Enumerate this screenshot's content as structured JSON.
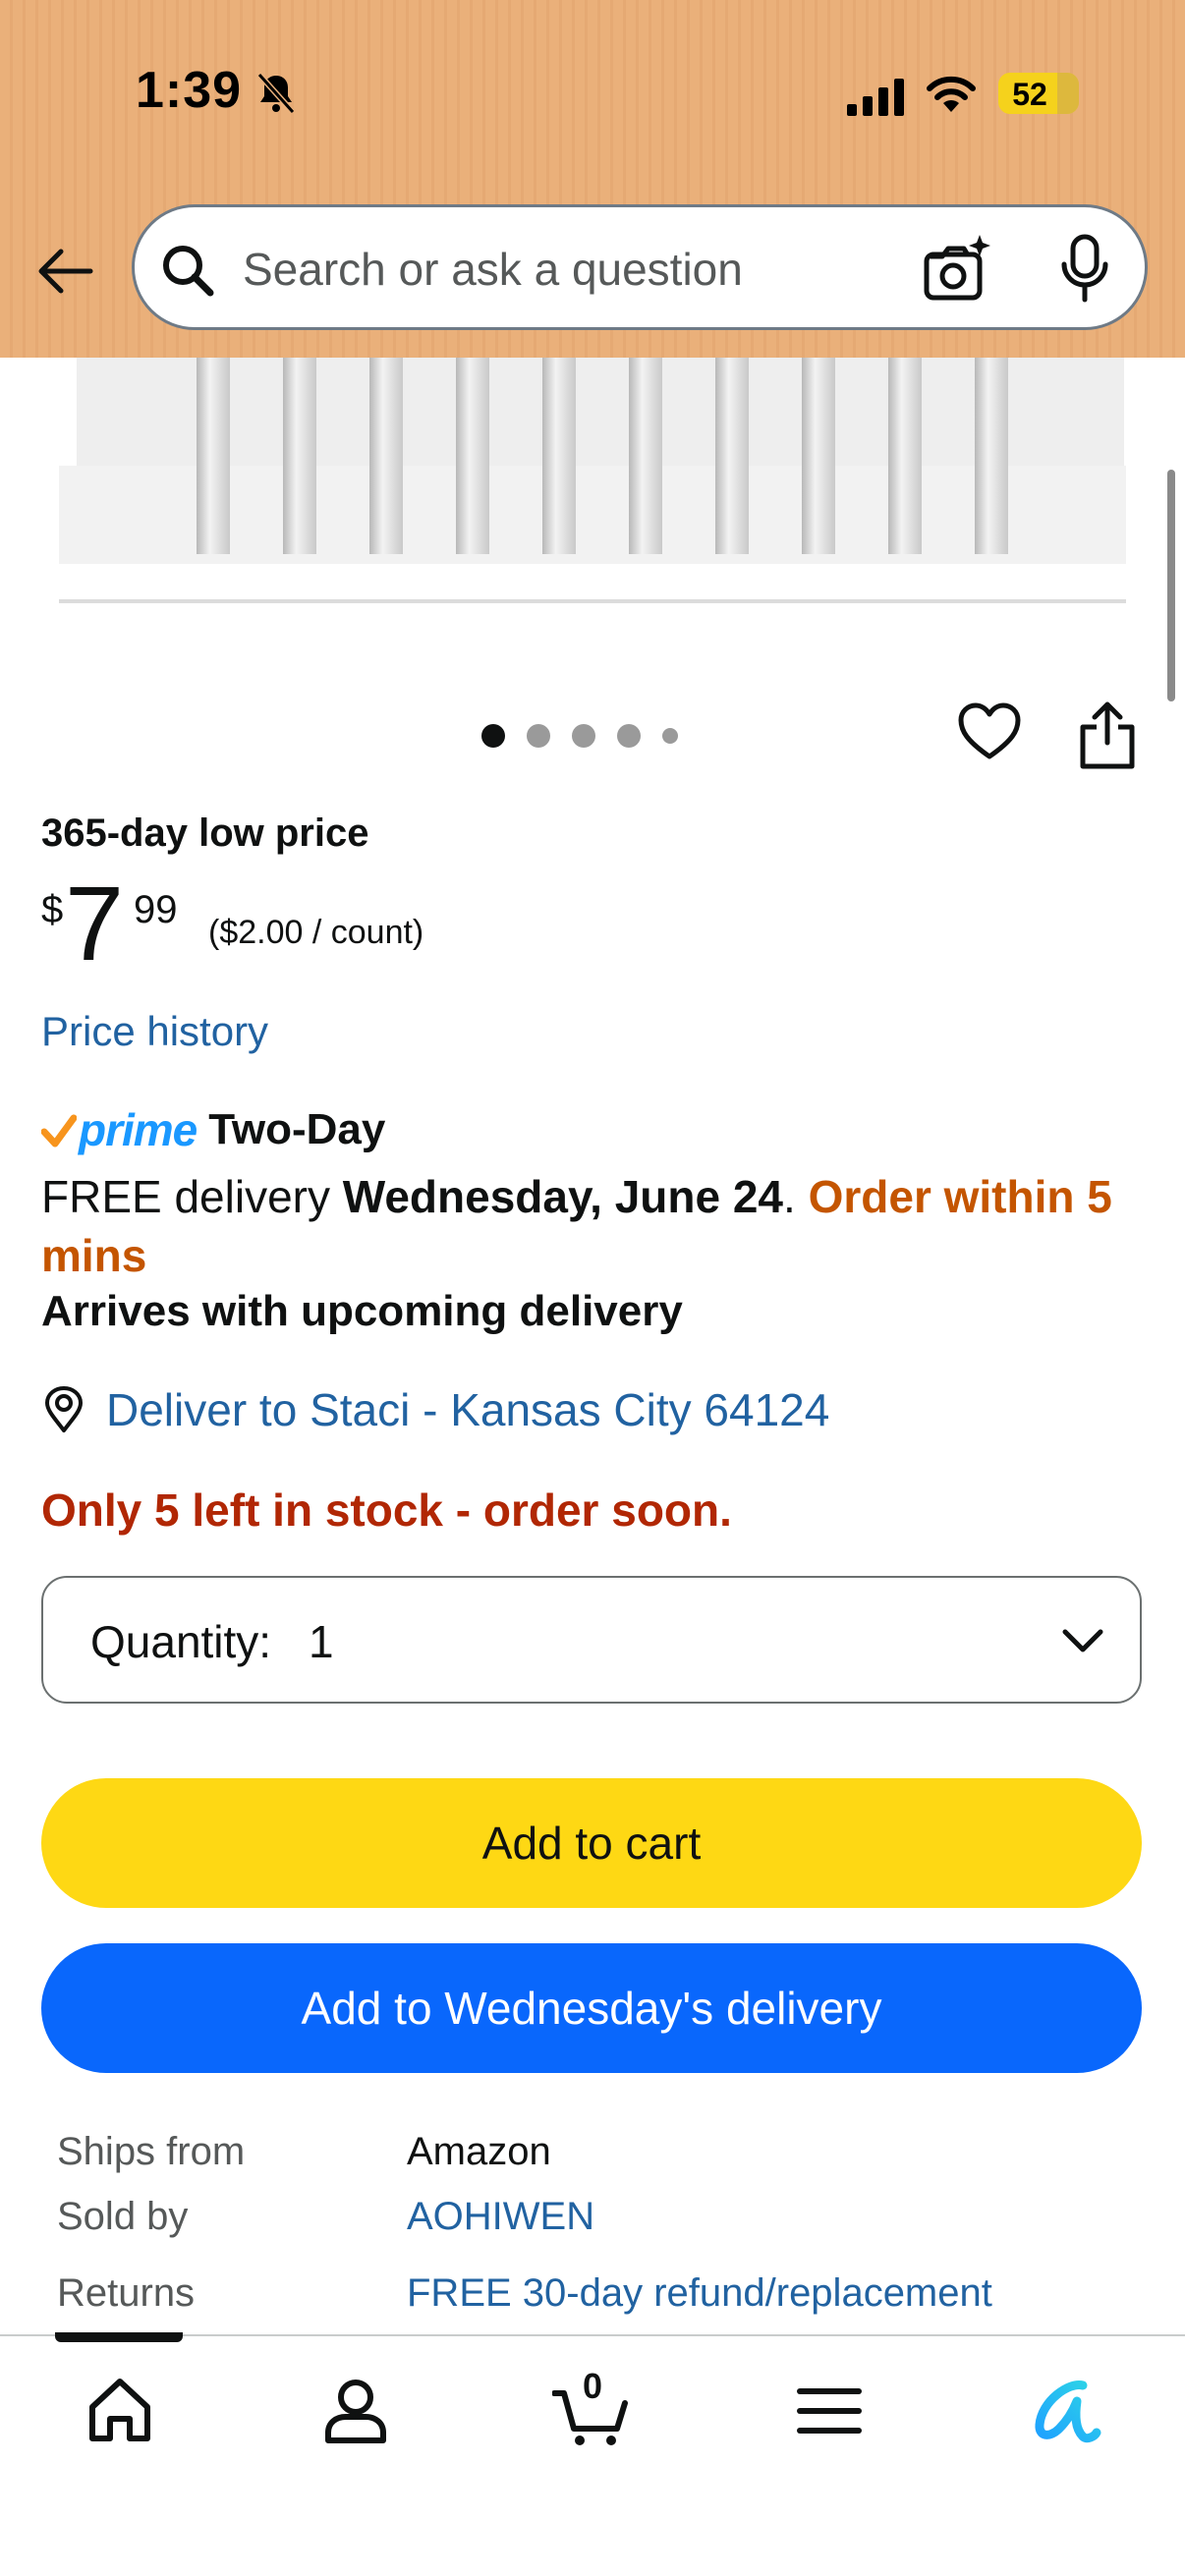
{
  "status_bar": {
    "time": "1:39",
    "battery": "52"
  },
  "search": {
    "placeholder": "Search or ask a question"
  },
  "carousel": {
    "dot_count": 5,
    "active_index": 0
  },
  "price": {
    "deal_label": "365-day low price",
    "symbol": "$",
    "whole": "7",
    "fraction": "99",
    "unit_price": "($2.00 / count)",
    "history_link": "Price history"
  },
  "delivery": {
    "prime_word": "prime",
    "prime_speed": "Two-Day",
    "free_prefix": "FREE delivery ",
    "date": "Wednesday, June 24",
    "period": ". ",
    "urgency": "Order within 5 mins",
    "arrives": "Arrives with upcoming delivery",
    "deliver_to": "Deliver to Staci - Kansas City 64124",
    "stock": "Only 5 left in stock - order soon."
  },
  "quantity": {
    "label": "Quantity:",
    "value": "1"
  },
  "buttons": {
    "add_to_cart": "Add to cart",
    "add_to_delivery": "Add to Wednesday's delivery"
  },
  "info": [
    {
      "key": "Ships from",
      "value": "Amazon"
    },
    {
      "key": "Sold by",
      "value": "AOHIWEN"
    },
    {
      "key": "Returns",
      "value": "FREE 30-day refund/replacement"
    }
  ],
  "nav": {
    "cart_count": "0"
  },
  "colors": {
    "header": "#eab07a",
    "add_to_cart": "#fed814",
    "add_to_delivery": "#0967fc",
    "link": "#2162a1",
    "urgent": "#c45500",
    "stock": "#b12704",
    "prime": "#1a98ff"
  }
}
